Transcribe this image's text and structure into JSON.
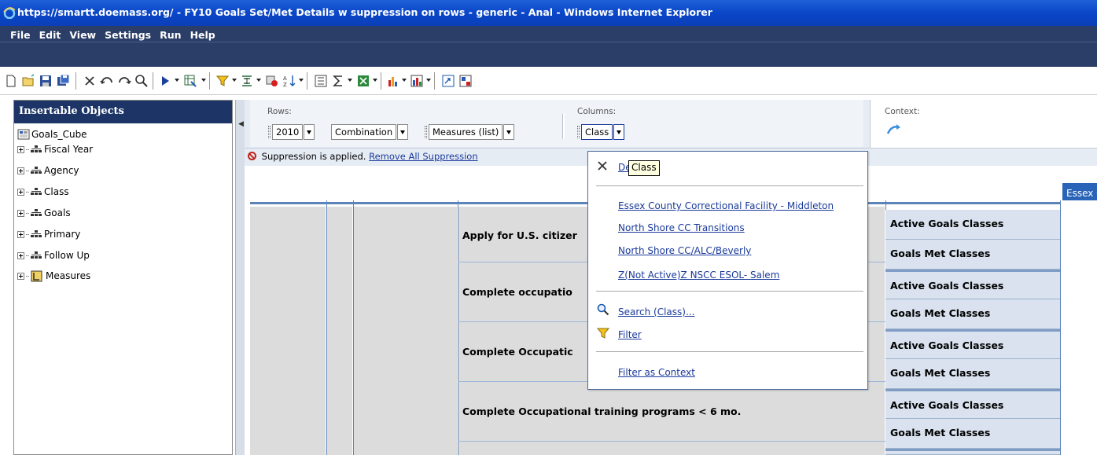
{
  "window": {
    "title": "https://smartt.doemass.org/ - FY10 Goals Set/Met Details w suppression on rows - generic - Anal - Windows Internet Explorer",
    "browser_icon": "ie-icon"
  },
  "menu": [
    "File",
    "Edit",
    "View",
    "Settings",
    "Run",
    "Help"
  ],
  "toolbar_icons": [
    "new-icon",
    "open-icon",
    "save-icon",
    "save-as-icon",
    "delete-icon",
    "undo-icon",
    "redo-icon",
    "find-icon",
    "run-icon",
    "view-icon",
    "filter-icon",
    "suppress-icon",
    "sort-icon",
    "calculate-icon",
    "summary-icon",
    "excel-icon",
    "chart-icon",
    "bar-chart-icon",
    "swap-icon",
    "layout-icon"
  ],
  "left_panel": {
    "header": "Insertable Objects",
    "root": "Goals_Cube",
    "items": [
      "Fiscal Year",
      "Agency",
      "Class",
      "Goals",
      "Primary",
      "Follow Up",
      "Measures"
    ]
  },
  "dropzones": {
    "rows_label": "Rows:",
    "row_items": [
      "2010",
      "Combination",
      "Measures (list)"
    ],
    "columns_label": "Columns:",
    "column_items": [
      "Class"
    ],
    "context_label": "Context:"
  },
  "suppression": {
    "text": "Suppression is applied.",
    "link": "Remove All Suppression"
  },
  "grid": {
    "goals": [
      "Apply for U.S. citizer",
      "Complete occupatio",
      "Complete Occupatic",
      "Complete Occupational training programs < 6 mo."
    ],
    "measures": [
      "Active Goals Classes",
      "Goals Met Classes"
    ],
    "column_header": "Essex County"
  },
  "popup": {
    "top_item": "De",
    "tooltip": "Class",
    "members": [
      "Essex County Correctional Facility - Middleton",
      "North Shore CC Transitions",
      "North Shore CC/ALC/Beverly",
      "Z(Not Active)Z NSCC ESOL- Salem"
    ],
    "search": "Search (Class)...",
    "filter": "Filter",
    "filter_context": "Filter as Context"
  }
}
